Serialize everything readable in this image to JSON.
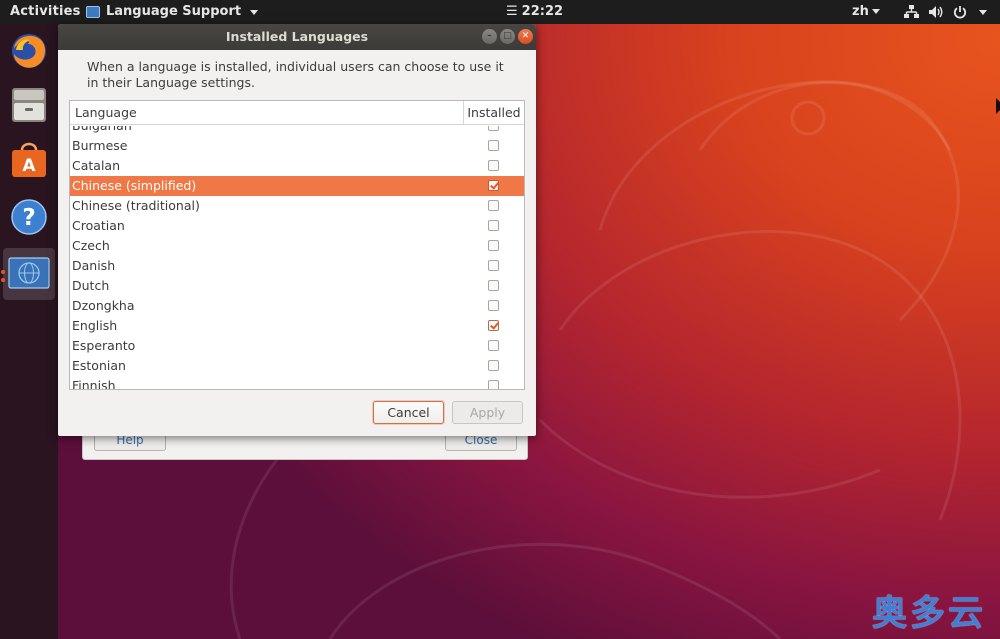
{
  "top_bar": {
    "activities": "Activities",
    "app_name": "Language Support",
    "clock": "22:22",
    "input_language": "zh"
  },
  "dock": {
    "items": [
      {
        "name": "Firefox"
      },
      {
        "name": "Files"
      },
      {
        "name": "Ubuntu Software"
      },
      {
        "name": "Help"
      },
      {
        "name": "Language Support"
      }
    ]
  },
  "dialog": {
    "title": "Installed Languages",
    "intro": "When a language is installed, individual users can choose to use it in their Language settings.",
    "table": {
      "col_language": "Language",
      "col_installed": "Installed",
      "rows": [
        {
          "label": "Bulgarian",
          "checked": false,
          "selected": false
        },
        {
          "label": "Burmese",
          "checked": false,
          "selected": false
        },
        {
          "label": "Catalan",
          "checked": false,
          "selected": false
        },
        {
          "label": "Chinese (simplified)",
          "checked": true,
          "selected": true
        },
        {
          "label": "Chinese (traditional)",
          "checked": false,
          "selected": false
        },
        {
          "label": "Croatian",
          "checked": false,
          "selected": false
        },
        {
          "label": "Czech",
          "checked": false,
          "selected": false
        },
        {
          "label": "Danish",
          "checked": false,
          "selected": false
        },
        {
          "label": "Dutch",
          "checked": false,
          "selected": false
        },
        {
          "label": "Dzongkha",
          "checked": false,
          "selected": false
        },
        {
          "label": "English",
          "checked": true,
          "selected": false
        },
        {
          "label": "Esperanto",
          "checked": false,
          "selected": false
        },
        {
          "label": "Estonian",
          "checked": false,
          "selected": false
        },
        {
          "label": "Finnish",
          "checked": false,
          "selected": false
        }
      ]
    },
    "cancel_label": "Cancel",
    "apply_label": "Apply"
  },
  "background_window": {
    "help_label": "Help",
    "close_label": "Close"
  },
  "watermark": "奥多云",
  "colors": {
    "accent": "#e95420",
    "selection": "#f07746",
    "titlebar": "#3c3b37",
    "panel": "#1d1d1d"
  }
}
